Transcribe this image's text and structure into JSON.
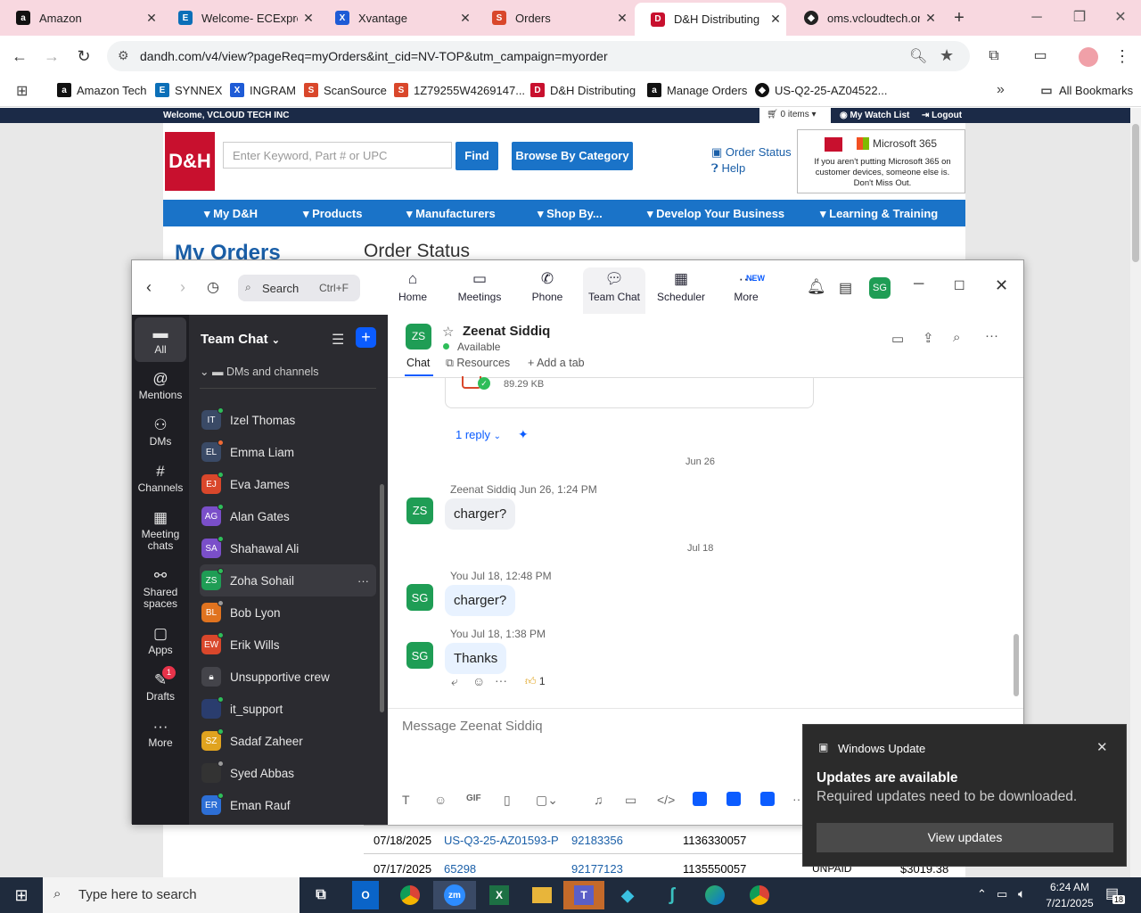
{
  "browser": {
    "tabs": [
      {
        "title": "Amazon",
        "icon": "amazon-icon"
      },
      {
        "title": "Welcome- ECExpre",
        "icon": "ec-icon"
      },
      {
        "title": "Xvantage",
        "icon": "xvantage-icon"
      },
      {
        "title": "Orders",
        "icon": "orders-icon"
      },
      {
        "title": "D&H Distributing",
        "icon": "dh-icon",
        "active": true
      },
      {
        "title": "oms.vcloudtech.org",
        "icon": "oms-icon"
      }
    ],
    "url": "dandh.com/v4/view?pageReq=myOrders&int_cid=NV-TOP&utm_campaign=myorder",
    "bookmarks": [
      "Amazon Tech",
      "SYNNEX",
      "INGRAM",
      "ScanSource",
      "1Z79255W4269147...",
      "D&H Distributing",
      "Manage Orders",
      "US-Q2-25-AZ04522..."
    ],
    "all_bookmarks": "All Bookmarks"
  },
  "site": {
    "welcome": "Welcome, VCLOUD TECH INC",
    "cart": "0 items",
    "watch_list": "My Watch List",
    "logout": "Logout",
    "logo": "D&H",
    "search_placeholder": "Enter Keyword, Part # or UPC",
    "find": "Find",
    "browse": "Browse By Category",
    "order_status_link": "Order Status",
    "help": "Help",
    "ad_brand": "Microsoft 365",
    "ad_text": "If you aren't putting Microsoft 365 on customer devices, someone else is. Don't Miss Out.",
    "nav": [
      "My D&H",
      "Products",
      "Manufacturers",
      "Shop By...",
      "Develop Your Business",
      "Learning & Training"
    ],
    "my_orders": "My Orders",
    "order_status_heading": "Order Status",
    "rows": [
      {
        "date": "07/18/2025",
        "po": "US-Q3-25-AZ01593-P",
        "order": "92183356",
        "invoice": "1136330057"
      },
      {
        "date": "07/17/2025",
        "po": "65298",
        "order": "92177123",
        "invoice": "1135550057",
        "status": "UNPAID",
        "amount": "$3019.38"
      }
    ]
  },
  "zoom": {
    "search": "Search",
    "search_shortcut": "Ctrl+F",
    "tabs": [
      "Home",
      "Meetings",
      "Phone",
      "Team Chat",
      "Scheduler",
      "More"
    ],
    "new_badge": "NEW",
    "user_initials": "SG",
    "rail": [
      "All",
      "Mentions",
      "DMs",
      "Channels",
      "Meeting chats",
      "Shared spaces",
      "Apps",
      "Drafts",
      "More"
    ],
    "drafts_badge": "1",
    "panel_title": "Team Chat",
    "section": "DMs and channels",
    "contacts": [
      {
        "initials": "IT",
        "name": "Izel Thomas",
        "color": "#3a4a66",
        "status": "#2ebd59"
      },
      {
        "initials": "EL",
        "name": "Emma Liam",
        "color": "#3a4a66",
        "status": "#f06a35"
      },
      {
        "initials": "EJ",
        "name": "Eva James",
        "color": "#d9472b",
        "status": "#2ebd59"
      },
      {
        "initials": "AG",
        "name": "Alan Gates",
        "color": "#7a4fc9",
        "status": "#2ebd59"
      },
      {
        "initials": "SA",
        "name": "Shahawal Ali",
        "color": "#7a4fc9",
        "status": "#2ebd59"
      },
      {
        "initials": "ZS",
        "name": "Zoha Sohail",
        "color": "#1f9d55",
        "status": "#2ebd59"
      },
      {
        "initials": "BL",
        "name": "Bob Lyon",
        "color": "#e0731f",
        "status": "#9a9a9a"
      },
      {
        "initials": "EW",
        "name": "Erik Wills",
        "color": "#d9472b",
        "status": "#2ebd59"
      },
      {
        "initials": "",
        "name": "Unsupportive crew",
        "color": "#44444a",
        "status": ""
      },
      {
        "initials": "",
        "name": "it_support",
        "color": "#2a3d6e",
        "status": "#2ebd59"
      },
      {
        "initials": "SZ",
        "name": "Sadaf Zaheer",
        "color": "#e0a31f",
        "status": "#2ebd59"
      },
      {
        "initials": "",
        "name": "Syed Abbas",
        "color": "#333",
        "status": "#9a9a9a"
      },
      {
        "initials": "ER",
        "name": "Eman Rauf",
        "color": "#2d6fd6",
        "status": "#2ebd59"
      }
    ],
    "chat": {
      "name": "Zeenat Siddiq",
      "initials": "ZS",
      "presence": "Available",
      "tabs": [
        "Chat",
        "Resources",
        "Add a tab"
      ],
      "file_size": "89.29 KB",
      "reply": "1 reply",
      "date1": "Jun 26",
      "msg1_meta": "Zeenat Siddiq Jun 26, 1:24 PM",
      "msg1": "charger?",
      "date2": "Jul 18",
      "msg2_meta": "You Jul 18, 12:48 PM",
      "msg2": "charger?",
      "msg3_meta": "You Jul 18, 1:38 PM",
      "msg3": "Thanks",
      "reaction_count": "1",
      "composer_placeholder": "Message Zeenat Siddiq"
    }
  },
  "notification": {
    "app": "Windows Update",
    "title": "Updates are available",
    "body": "Required updates need to be downloaded.",
    "button": "View updates"
  },
  "taskbar": {
    "search_placeholder": "Type here to search",
    "time": "6:24 AM",
    "date": "7/21/2025",
    "notif_count": "18"
  }
}
